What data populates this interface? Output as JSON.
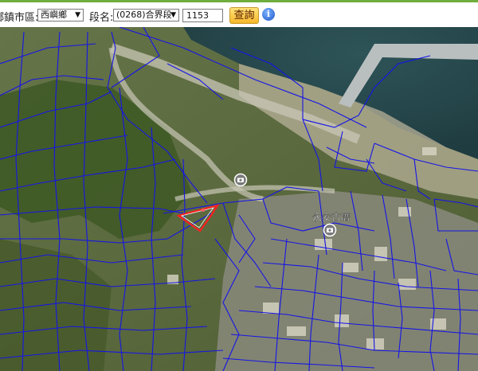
{
  "toolbar": {
    "district_label": "鄉鎮市區:",
    "district_value": "西嶼鄉",
    "section_label": "段名:",
    "section_value": "(0268)合界段",
    "parcel_value": "1153",
    "query_button": "查詢",
    "info_icon": "i"
  },
  "map": {
    "place_label": "永安古厝",
    "parcel_line_color": "#1515e6",
    "highlight_color": "#ff2020"
  }
}
